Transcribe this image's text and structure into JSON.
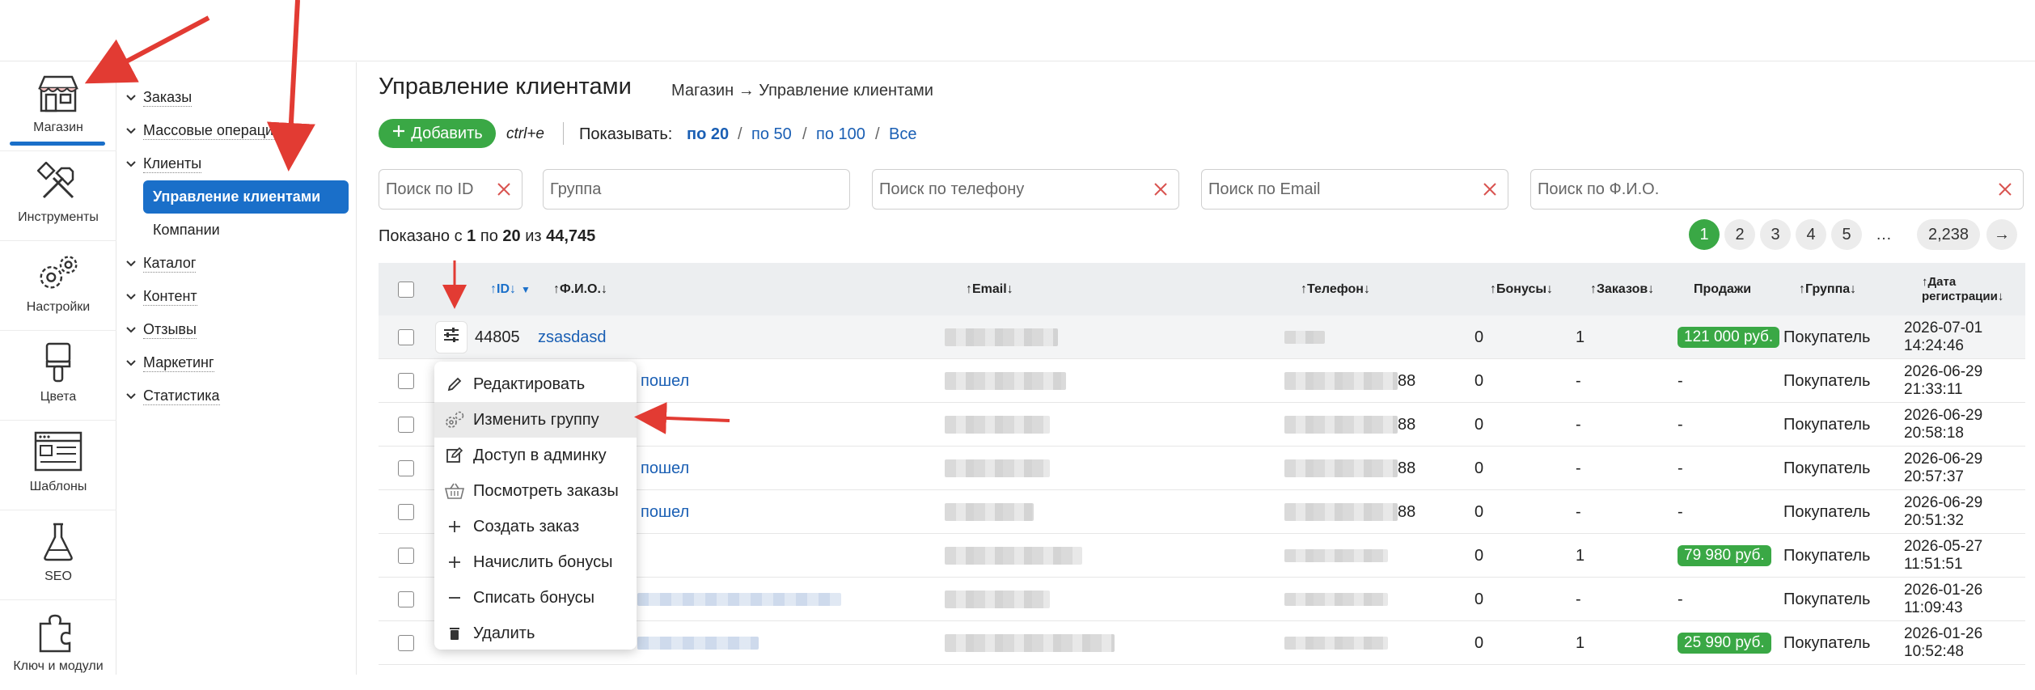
{
  "rail": [
    {
      "label": "Магазин",
      "icon": "store-icon",
      "active": true
    },
    {
      "label": "Инструменты",
      "icon": "tools-icon"
    },
    {
      "label": "Настройки",
      "icon": "gears-icon"
    },
    {
      "label": "Цвета",
      "icon": "brush-icon"
    },
    {
      "label": "Шаблоны",
      "icon": "template-icon"
    },
    {
      "label": "SEO",
      "icon": "flask-icon"
    },
    {
      "label": "Ключ и модули",
      "icon": "puzzle-icon"
    }
  ],
  "tree": {
    "orders": "Заказы",
    "bulk": "Массовые операции",
    "clients": "Клиенты",
    "clients_manage": "Управление клиентами",
    "companies": "Компании",
    "catalog": "Каталог",
    "content": "Контент",
    "reviews": "Отзывы",
    "marketing": "Маркетинг",
    "stats": "Статистика"
  },
  "header": {
    "title": "Управление клиентами",
    "breadcrumb": "Магазин → Управление клиентами"
  },
  "toolbar": {
    "add_label": "Добавить",
    "hotkey": "ctrl+e",
    "show_label": "Показывать:",
    "per_page": [
      "по 20",
      "по 50",
      "по 100",
      "Все"
    ]
  },
  "filters": {
    "id": "Поиск по ID",
    "group": "Группа",
    "phone": "Поиск по телефону",
    "email": "Поиск по Email",
    "fio": "Поиск по Ф.И.О."
  },
  "summary": {
    "prefix": "Показано с",
    "from": "1",
    "mid": "по",
    "to": "20",
    "of": "из",
    "total": "44,745"
  },
  "pagination": {
    "pages": [
      "1",
      "2",
      "3",
      "4",
      "5",
      "…",
      "2,238"
    ],
    "next": "→"
  },
  "columns": {
    "id": "↑ID↓",
    "fio": "↑Ф.И.О.↓",
    "email": "↑Email↓",
    "phone": "↑Телефон↓",
    "bonus": "↑Бонусы↓",
    "orders": "↑Заказов↓",
    "sales": "Продажи",
    "group": "↑Группа↓",
    "date1": "↑Дата",
    "date2": "регистрации↓"
  },
  "rows": [
    {
      "id": "44805",
      "name": "zsasdasd",
      "phone_tail": "",
      "bonus": "0",
      "orders": "1",
      "sales": "121 000 руб.",
      "group": "Покупатель",
      "d1": "2026-07-01",
      "d2": "14:24:46"
    },
    {
      "id": "",
      "name": "пошел",
      "phone_tail": "88",
      "bonus": "0",
      "orders": "-",
      "sales": "-",
      "group": "Покупатель",
      "d1": "2026-06-29",
      "d2": "21:33:11"
    },
    {
      "id": "",
      "name": "",
      "phone_tail": "88",
      "bonus": "0",
      "orders": "-",
      "sales": "-",
      "group": "Покупатель",
      "d1": "2026-06-29",
      "d2": "20:58:18"
    },
    {
      "id": "",
      "name": "пошел",
      "phone_tail": "88",
      "bonus": "0",
      "orders": "-",
      "sales": "-",
      "group": "Покупатель",
      "d1": "2026-06-29",
      "d2": "20:57:37"
    },
    {
      "id": "",
      "name": "пошел",
      "phone_tail": "88",
      "bonus": "0",
      "orders": "-",
      "sales": "-",
      "group": "Покупатель",
      "d1": "2026-06-29",
      "d2": "20:51:32"
    },
    {
      "id": "",
      "name": "",
      "phone_tail": "",
      "bonus": "0",
      "orders": "1",
      "sales": "79 980 руб.",
      "group": "Покупатель",
      "d1": "2026-05-27",
      "d2": "11:51:51"
    },
    {
      "id": "",
      "name": "",
      "phone_tail": "",
      "bonus": "0",
      "orders": "-",
      "sales": "-",
      "group": "Покупатель",
      "d1": "2026-01-26",
      "d2": "11:09:43"
    },
    {
      "id": "",
      "name": "",
      "phone_tail": "",
      "bonus": "0",
      "orders": "1",
      "sales": "25 990 руб.",
      "group": "Покупатель",
      "d1": "2026-01-26",
      "d2": "10:52:48"
    }
  ],
  "menu": [
    {
      "label": "Редактировать",
      "icon": "pencil-icon"
    },
    {
      "label": "Изменить группу",
      "icon": "gears-icon"
    },
    {
      "label": "Доступ в админку",
      "icon": "edit-box-icon"
    },
    {
      "label": "Посмотреть заказы",
      "icon": "basket-icon"
    },
    {
      "label": "Создать заказ",
      "icon": "plus-icon"
    },
    {
      "label": "Начислить бонусы",
      "icon": "plus-icon"
    },
    {
      "label": "Списать бонусы",
      "icon": "minus-icon"
    },
    {
      "label": "Удалить",
      "icon": "trash-icon"
    }
  ],
  "colors": {
    "accent": "#1a6fc9",
    "green": "#3aa845",
    "link": "#1a5fb4",
    "arrow": "#e23b33"
  }
}
